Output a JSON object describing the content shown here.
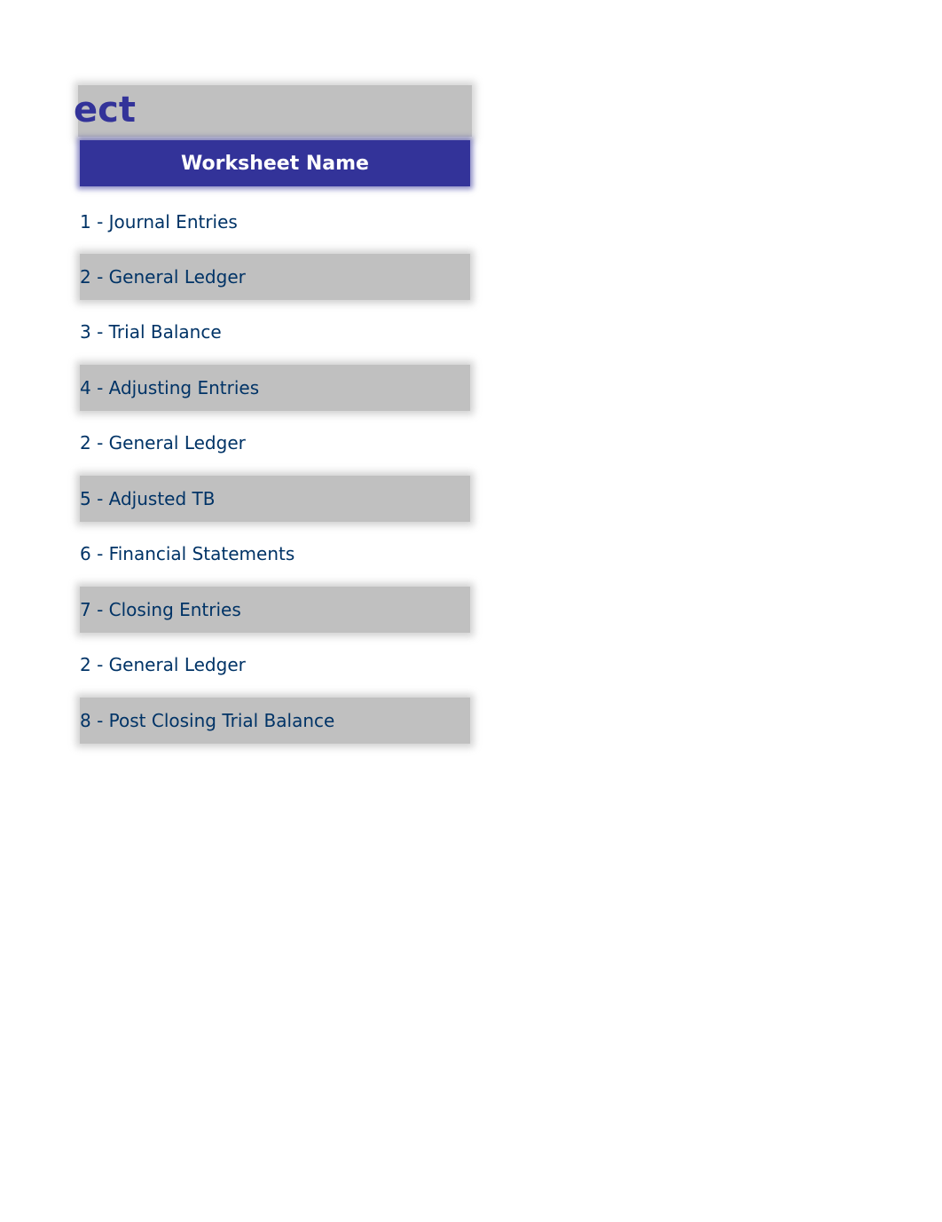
{
  "title": "ect",
  "table": {
    "header": "Worksheet Name",
    "rows": [
      {
        "label": "1 - Journal Entries",
        "shaded": false
      },
      {
        "label": "2 - General Ledger",
        "shaded": true
      },
      {
        "label": "3 - Trial Balance",
        "shaded": false
      },
      {
        "label": "4 - Adjusting Entries",
        "shaded": true
      },
      {
        "label": "2 - General Ledger",
        "shaded": false
      },
      {
        "label": "5 - Adjusted TB",
        "shaded": true
      },
      {
        "label": "6 - Financial Statements",
        "shaded": false
      },
      {
        "label": "7 - Closing Entries",
        "shaded": true
      },
      {
        "label": "2 - General Ledger",
        "shaded": false
      },
      {
        "label": "8 - Post Closing Trial Balance",
        "shaded": true
      }
    ]
  },
  "colors": {
    "title": "#333399",
    "header_bg": "#333399",
    "header_text": "#ffffff",
    "row_text": "#003366",
    "shaded_bg": "#c0c0c0"
  }
}
